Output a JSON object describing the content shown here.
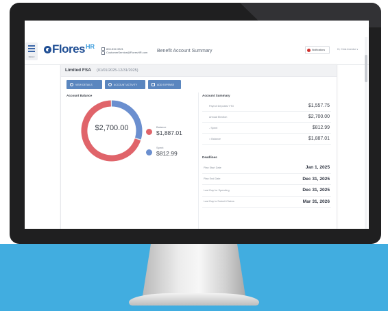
{
  "header": {
    "menu_label": "MENU",
    "logo_text": "Flores",
    "logo_sup": "HR",
    "phone": "800-532-3321",
    "email": "CustomerService@FloresHR.com",
    "page_title": "Benefit Account Summary",
    "notifications_label": "Notifications",
    "user_menu": "Hi, Chris Inventor ∨"
  },
  "card": {
    "plan_name": "Limited FSA",
    "plan_dates": "(01/01/2025-12/31/2025)",
    "actions": [
      {
        "label": "VIEW DETAILS",
        "icon": "info-icon"
      },
      {
        "label": "ACCOUNT ACTIVITY",
        "icon": "activity-icon"
      },
      {
        "label": "ADD EXPENSE",
        "icon": "receipt-icon"
      }
    ]
  },
  "balance": {
    "title": "Account Balance",
    "center_value": "$2,700.00",
    "legend": [
      {
        "label": "Balance",
        "value": "$1,887.01",
        "color": "#e0646a"
      },
      {
        "label": "Spent",
        "value": "$812.99",
        "color": "#6b8fcf"
      }
    ]
  },
  "summary": {
    "title": "Account Summary",
    "rows": [
      {
        "label": "Payroll Deposits YTD",
        "value": "$1,557.75"
      },
      {
        "label": "Annual Election",
        "value": "$2,700.00"
      },
      {
        "label": "- Spent",
        "value": "$812.99"
      },
      {
        "label": "= Balance",
        "value": "$1,887.01"
      }
    ]
  },
  "deadlines": {
    "title": "Deadlines",
    "rows": [
      {
        "label": "Plan Start Date",
        "value": "Jan 1, 2025"
      },
      {
        "label": "Plan End Date",
        "value": "Dec 31, 2025"
      },
      {
        "label": "Last Day for Spending",
        "value": "Dec 31, 2025"
      },
      {
        "label": "Last Day to Submit Claims",
        "value": "Mar 31, 2026"
      }
    ]
  },
  "colors": {
    "brand": "#1f4e94",
    "brand_accent": "#3a9bdc",
    "button": "#5a86bf",
    "balance": "#e0646a",
    "spent": "#6b8fcf",
    "desk": "#41ade0"
  }
}
